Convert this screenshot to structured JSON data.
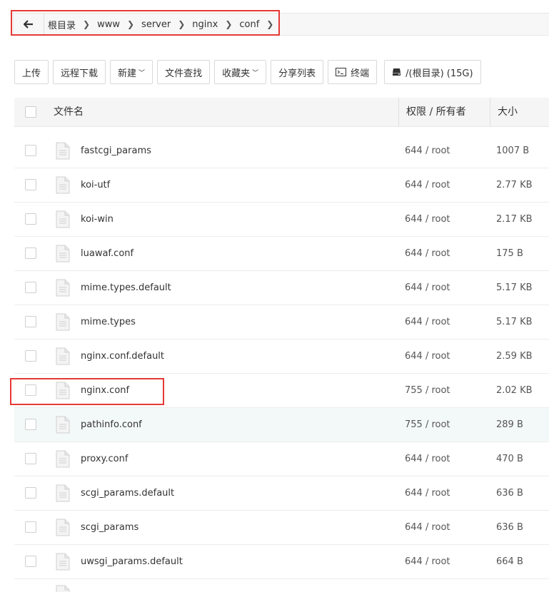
{
  "breadcrumb": {
    "back_icon": "arrow-left-icon",
    "crumbs": [
      "根目录",
      "www",
      "server",
      "nginx",
      "conf"
    ]
  },
  "toolbar": {
    "upload": "上传",
    "remote_download": "远程下载",
    "new": "新建",
    "file_search": "文件查找",
    "favorites": "收藏夹",
    "share_list": "分享列表",
    "terminal": "终端",
    "disk": "/(根目录) (15G)"
  },
  "table": {
    "header": {
      "name": "文件名",
      "perm": "权限 / 所有者",
      "size": "大小"
    },
    "rows": [
      {
        "name": "fastcgi_params",
        "perm": "644 / root",
        "size": "1007 B"
      },
      {
        "name": "koi-utf",
        "perm": "644 / root",
        "size": "2.77 KB"
      },
      {
        "name": "koi-win",
        "perm": "644 / root",
        "size": "2.17 KB"
      },
      {
        "name": "luawaf.conf",
        "perm": "644 / root",
        "size": "175 B"
      },
      {
        "name": "mime.types.default",
        "perm": "644 / root",
        "size": "5.17 KB"
      },
      {
        "name": "mime.types",
        "perm": "644 / root",
        "size": "5.17 KB"
      },
      {
        "name": "nginx.conf.default",
        "perm": "644 / root",
        "size": "2.59 KB"
      },
      {
        "name": "nginx.conf",
        "perm": "755 / root",
        "size": "2.02 KB"
      },
      {
        "name": "pathinfo.conf",
        "perm": "755 / root",
        "size": "289 B"
      },
      {
        "name": "proxy.conf",
        "perm": "644 / root",
        "size": "470 B"
      },
      {
        "name": "scgi_params.default",
        "perm": "644 / root",
        "size": "636 B"
      },
      {
        "name": "scgi_params",
        "perm": "644 / root",
        "size": "636 B"
      },
      {
        "name": "uwsgi_params.default",
        "perm": "644 / root",
        "size": "664 B"
      }
    ]
  },
  "colors": {
    "highlight_border": "#e53935",
    "hover_row": "#f3f9f8"
  }
}
